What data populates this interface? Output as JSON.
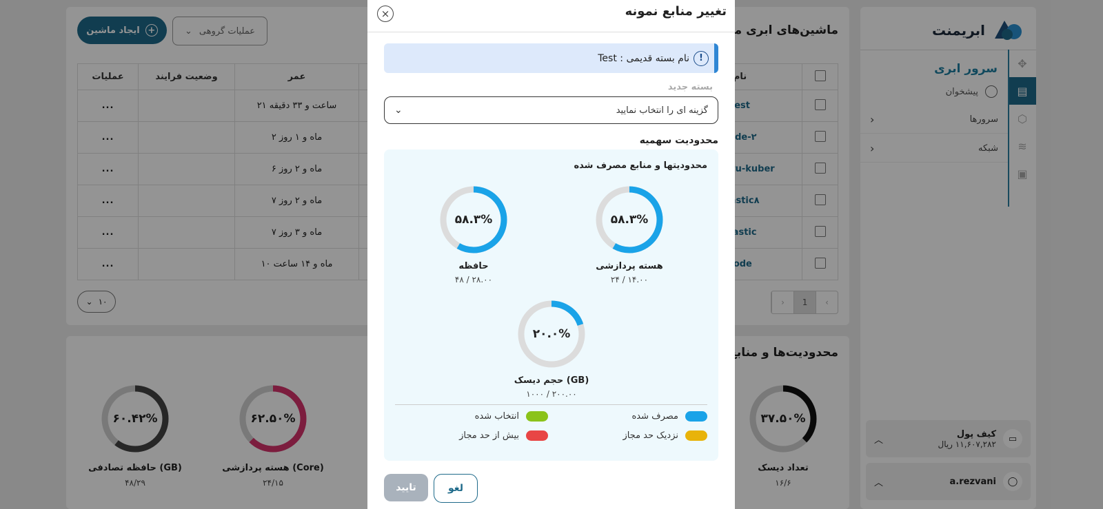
{
  "colors": {
    "used": "#1aa3e8",
    "selected": "#8bc31a",
    "near_limit": "#e8b30a",
    "over_limit": "#e84545",
    "track": "#dcdcdc",
    "brand": "#1e6a8a"
  },
  "sidebar": {
    "brand": "ابریمنت",
    "section_title": "سرور ابری",
    "dashboard": "پیشخوان",
    "items": [
      {
        "label": "سرورها",
        "icon": "chevron-left-icon"
      },
      {
        "label": "شبکه",
        "icon": "chevron-left-icon"
      }
    ],
    "wallet_label": "کیف پول",
    "wallet_value": "۱۱,۶۰۷,۲۸۲ ریال",
    "username": "a.rezvani"
  },
  "main": {
    "title": "ماشین‌های ابری من",
    "create_button": "ایجاد ماشین",
    "group_ops_button": "عملیات گروهی",
    "columns": [
      "نام",
      "عمر",
      "وضعیت فرایند",
      "عملیات"
    ],
    "rows": [
      {
        "name": "test",
        "age": "۲۱ ساعت و ۳۳ دقیقه",
        "actions": "..."
      },
      {
        "name": "code-۲",
        "age": "۲ ماه و ۱ روز",
        "actions": "..."
      },
      {
        "name": "ubuntu-kuber",
        "age": "۶ ماه و ۲ روز",
        "actions": "..."
      },
      {
        "name": "elastic۸",
        "age": "۷ ماه و ۲ روز",
        "actions": "..."
      },
      {
        "name": "elastic",
        "age": "۷ ماه و ۳ روز",
        "actions": "..."
      },
      {
        "name": "code",
        "age": "۱۰ ماه و ۱۴ ساعت",
        "actions": "..."
      }
    ],
    "page_size": "۱۰",
    "current_page": "1"
  },
  "limits": {
    "title": "محدودیت‌ها و منابع",
    "rings": [
      {
        "label": "تعداد دیسک",
        "value": "۱۶/۶",
        "percent_text": "۳۷.۵۰%",
        "percent": 37.5,
        "color": "#111111"
      },
      {
        "label": "هسته پردازشی (Core)",
        "value": "۲۴/۱۵",
        "percent_text": "۶۲.۵۰%",
        "percent": 62.5,
        "color": "#d6336c"
      },
      {
        "label": "حافظه تصادفی (GB)",
        "value": "۴۸/۲۹",
        "percent_text": "۶۰.۴۲%",
        "percent": 60.42,
        "color": "#444444"
      }
    ]
  },
  "modal": {
    "title": "تغییر منابع نمونه",
    "info_text": "نام بسته قدیمی : Test",
    "new_package_label": "بسته جدید",
    "select_placeholder": "گزینه ای را انتخاب نمایید",
    "quota_label": "محدودیت سهمیه",
    "panel_title": "محدودیتها و منابع مصرف شده",
    "rings": [
      {
        "label": "هسته پردازشی",
        "value": "۲۴ / ۱۴.۰۰",
        "percent_text": "۵۸.۳%",
        "percent": 58.3
      },
      {
        "label": "حافظه",
        "value": "۴۸ / ۲۸.۰۰",
        "percent_text": "۵۸.۳%",
        "percent": 58.3
      },
      {
        "label": "حجم دیسک (GB)",
        "value": "۱۰۰۰ / ۲۰۰.۰۰",
        "percent_text": "۲۰.۰%",
        "percent": 20.0
      }
    ],
    "legend": {
      "used": "مصرف شده",
      "selected": "انتخاب شده",
      "near_limit": "نزدیک حد مجاز",
      "over_limit": "بیش از حد مجاز"
    },
    "confirm_button": "تایید",
    "cancel_button": "لغو"
  }
}
